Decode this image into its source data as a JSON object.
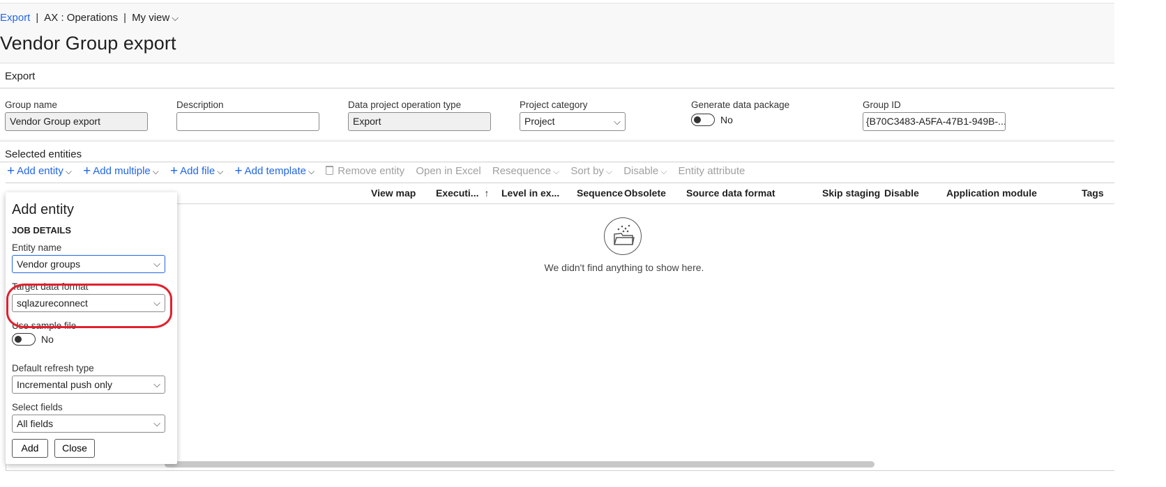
{
  "breadcrumb": {
    "link": "Export",
    "company": "AX : Operations",
    "view": "My view"
  },
  "page_title": "Vendor Group export",
  "export_section": {
    "heading": "Export",
    "fields": {
      "group_name": {
        "label": "Group name",
        "value": "Vendor Group export"
      },
      "description": {
        "label": "Description",
        "value": ""
      },
      "operation_type": {
        "label": "Data project operation type",
        "value": "Export"
      },
      "project_category": {
        "label": "Project category",
        "value": "Project"
      },
      "generate_package": {
        "label": "Generate data package",
        "value": "No"
      },
      "group_id": {
        "label": "Group ID",
        "value": "{B70C3483-A5FA-47B1-949B-..."
      }
    }
  },
  "entities_section": {
    "heading": "Selected entities",
    "toolbar": {
      "add_entity": "Add entity",
      "add_multiple": "Add multiple",
      "add_file": "Add file",
      "add_template": "Add template",
      "remove_entity": "Remove entity",
      "open_in_excel": "Open in Excel",
      "resequence": "Resequence",
      "sort_by": "Sort by",
      "disable": "Disable",
      "entity_attribute": "Entity attribute"
    },
    "columns": {
      "view_map": "View map",
      "execution": "Executi...",
      "level": "Level in ex...",
      "sequence": "Sequence",
      "obsolete": "Obsolete",
      "source_format": "Source data format",
      "skip_staging": "Skip staging",
      "disable": "Disable",
      "app_module": "Application module",
      "tags": "Tags"
    },
    "empty_message": "We didn't find anything to show here."
  },
  "add_entity_panel": {
    "title": "Add entity",
    "subtitle": "JOB DETAILS",
    "entity_name": {
      "label": "Entity name",
      "value": "Vendor groups"
    },
    "target_format": {
      "label": "Target data format",
      "value": "sqlazureconnect"
    },
    "use_sample_file": {
      "label": "Use sample file",
      "value": "No"
    },
    "refresh_type": {
      "label": "Default refresh type",
      "value": "Incremental push only"
    },
    "select_fields": {
      "label": "Select fields",
      "value": "All fields"
    },
    "add_button": "Add",
    "close_button": "Close"
  },
  "colors": {
    "link": "#2266e3",
    "highlight": "#e0202c"
  }
}
